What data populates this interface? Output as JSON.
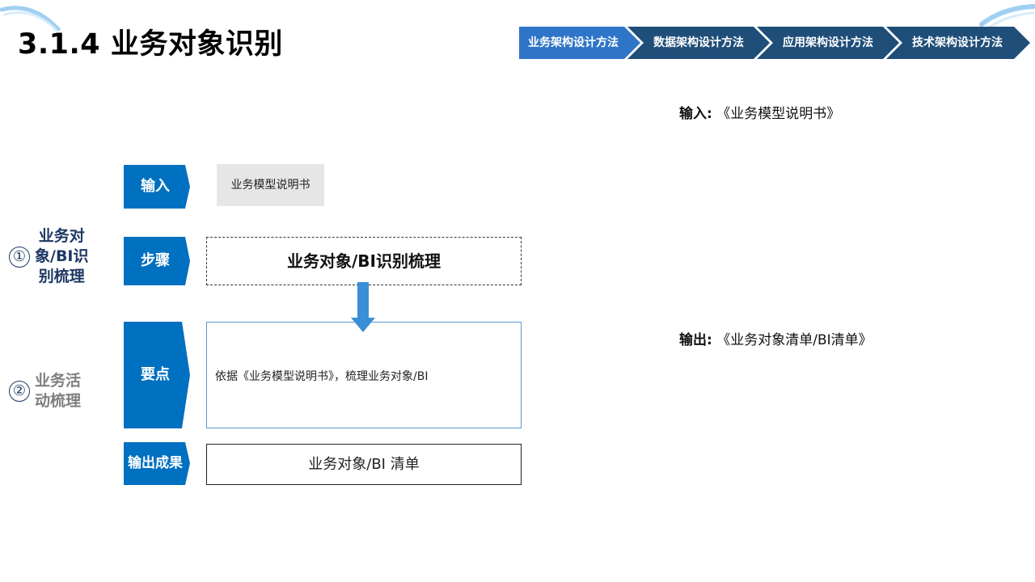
{
  "title": "3.1.4 业务对象识别",
  "nav": [
    {
      "label": "业务架构设计方法",
      "active": true
    },
    {
      "label": "数据架构设计方法",
      "active": false
    },
    {
      "label": "应用架构设计方法",
      "active": false
    },
    {
      "label": "技术架构设计方法",
      "active": false
    }
  ],
  "io": {
    "input_label": "输入:",
    "input_value": "《业务模型说明书》",
    "output_label": "输出:",
    "output_value": "《业务对象清单/BI清单》"
  },
  "stages": [
    {
      "num": "①",
      "lines": [
        "业务对",
        "象/BI识",
        "别梳理"
      ],
      "active": true
    },
    {
      "num": "②",
      "lines": [
        "业务活",
        "动梳理"
      ],
      "active": false
    }
  ],
  "tags": {
    "input": "输入",
    "step": "步骤",
    "points": "要点",
    "output": "输出成果"
  },
  "content": {
    "input_doc": "业务模型说明书",
    "step": "业务对象/BI识别梳理",
    "points": "依据《业务模型说明书》，梳理业务对象/BI",
    "output": "业务对象/BI 清单"
  },
  "colors": {
    "nav_active": "#2e75c7",
    "nav_inactive": "#1f4e79",
    "tag_blue": "#0070c0",
    "stage_active": "#1f3864",
    "stage_inactive": "#7f7f7f",
    "arrow": "#3a8fd6"
  }
}
